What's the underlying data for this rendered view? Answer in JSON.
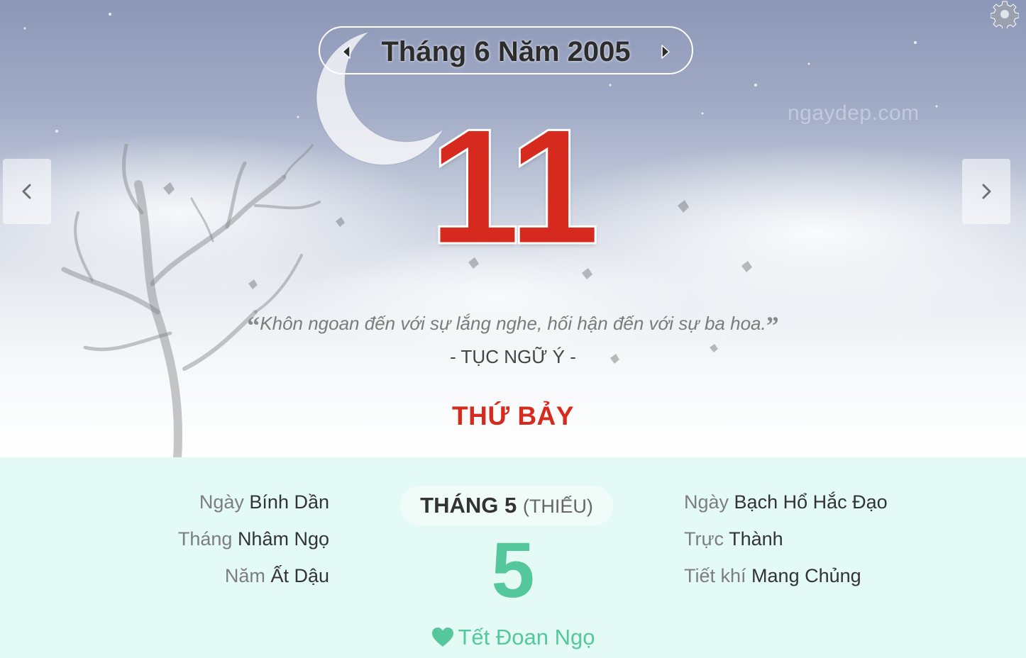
{
  "header": {
    "month_title": "Tháng 6 Năm 2005",
    "watermark": "ngaydep.com"
  },
  "day": {
    "number": "11",
    "weekday": "THỨ BẢY"
  },
  "quote": {
    "text": "Khôn ngoan đến với sự lắng nghe, hối hận đến với sự ba hoa.",
    "open_mark": "“",
    "close_mark": "”",
    "author": "- TỤC NGỮ Ý -"
  },
  "lunar": {
    "left": [
      {
        "label": "Ngày",
        "value": "Bính Dần"
      },
      {
        "label": "Tháng",
        "value": "Nhâm Ngọ"
      },
      {
        "label": "Năm",
        "value": "Ất Dậu"
      }
    ],
    "right": [
      {
        "label": "Ngày",
        "value": "Bạch Hổ Hắc Đạo"
      },
      {
        "label": "Trực",
        "value": "Thành"
      },
      {
        "label": "Tiết khí",
        "value": "Mang Chủng"
      }
    ],
    "month_label": "THÁNG 5",
    "month_type": "(THIẾU)",
    "day": "5",
    "festival": "Tết Đoan Ngọ"
  },
  "icons": {
    "settings": "gear-icon",
    "prev_month": "caret-left-icon",
    "next_month": "caret-right-icon",
    "prev_day": "chevron-left-icon",
    "next_day": "chevron-right-icon",
    "festival": "heart-icon"
  },
  "colors": {
    "day_red": "#d62a1e",
    "lunar_green": "#55c79d",
    "lunar_bg": "#e4fbf5"
  }
}
